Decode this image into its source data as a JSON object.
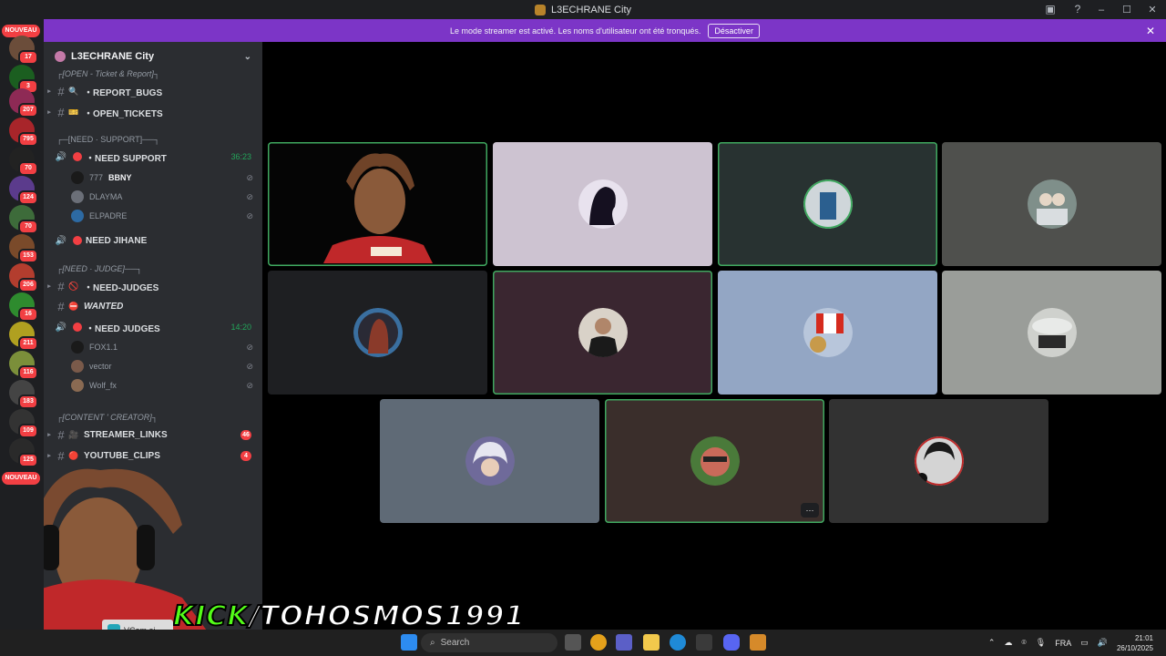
{
  "window": {
    "title": "L3ECHRANE City",
    "controls": [
      "–",
      "☐",
      "✕"
    ]
  },
  "banner": {
    "message": "Le mode streamer est activé. Les noms d'utilisateur ont été tronqués.",
    "button_label": "Désactiver",
    "close": "✕"
  },
  "rail": {
    "nouveau_label": "NOUVEAU",
    "badges": [
      "17",
      "3",
      "207",
      "795",
      "70",
      "124",
      "70",
      "153",
      "206",
      "16",
      "211",
      "116",
      "183",
      "109",
      "125"
    ]
  },
  "sidebar": {
    "server_name": "L3ECHRANE City",
    "categories": {
      "open": "┌[OPEN - Ticket & Report]┐",
      "support": "┌─[NEED · SUPPORT]──┐",
      "judge": "┌[NEED · JUDGE]──┐",
      "content": "┌[CONTENT ' CREATOR]┐"
    },
    "channels": {
      "report_bugs": "・REPORT_BUGS",
      "open_tickets": "・OPEN_TICKETS",
      "need_support": "・NEED SUPPORT",
      "need_support_time": "36:23",
      "need_jihane": "NEED JIHANE",
      "need_judges_text": "・NEED-JUDGES",
      "wanted": "WANTED",
      "need_judges_voice": "・NEED JUDGES",
      "need_judges_time": "14:20",
      "streamer_links": "STREAMER_LINKS",
      "streamer_links_count": "46",
      "youtube_clips": "YOUTUBE_CLIPS",
      "youtube_clips_count": "4"
    },
    "members_support": [
      "777",
      "DLAYMA",
      "ELPADRE"
    ],
    "member_tag": "BBNY",
    "members_judges": [
      "FOX1.1",
      "vector",
      "Wolf_fx"
    ]
  },
  "overlay": {
    "kick_prefix": "KICK",
    "kick_rest": "/TOHOSMOS1991",
    "vcam_label": "VCam.ai"
  },
  "taskbar": {
    "search_placeholder": "Search",
    "language": "FRA",
    "time": "21:01",
    "date": "26/10/2025"
  },
  "colors": {
    "accent_banner": "#7c35c7",
    "speaking": "#3fa85f",
    "badge_red": "#f23f43",
    "kick_green": "#53fc18"
  }
}
